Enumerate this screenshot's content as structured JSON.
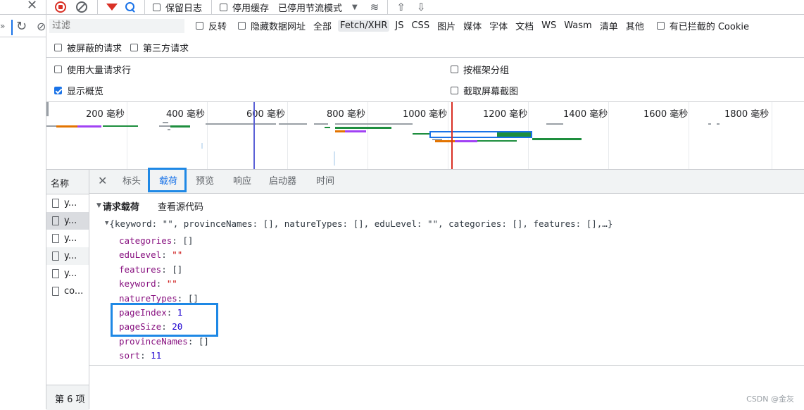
{
  "toolbar": {
    "preserve_log": "保留日志",
    "disable_cache": "停用缓存",
    "throttle": "已停用节流模式"
  },
  "filter_bar": {
    "placeholder": "过滤",
    "invert": "反转",
    "hide_data_urls": "隐藏数据网址",
    "types": [
      "全部",
      "Fetch/XHR",
      "JS",
      "CSS",
      "图片",
      "媒体",
      "字体",
      "文档",
      "WS",
      "Wasm",
      "清单",
      "其他"
    ],
    "active_type": "Fetch/XHR",
    "blocked_cookies": "有已拦截的 Cookie",
    "blocked_requests": "被屏蔽的请求",
    "third_party": "第三方请求"
  },
  "settings": {
    "big_rows": "使用大量请求行",
    "group_by_frame": "按框架分组",
    "show_overview": "显示概览",
    "capture_screenshots": "截取屏幕截图"
  },
  "overview": {
    "ticks": [
      "200 毫秒",
      "400 毫秒",
      "600 毫秒",
      "800 毫秒",
      "1000 毫秒",
      "1200 毫秒",
      "1400 毫秒",
      "1600 毫秒",
      "1800 毫秒"
    ]
  },
  "request_list": {
    "header": "名称",
    "items": [
      "y...",
      "y...",
      "y...",
      "y...",
      "y...",
      "co..."
    ],
    "footer": "第 6 项"
  },
  "details": {
    "tabs": [
      "标头",
      "载荷",
      "预览",
      "响应",
      "启动器",
      "时间"
    ],
    "active_tab": "载荷",
    "section_title": "请求载荷",
    "view_source": "查看源代码",
    "summary": "{keyword: \"\", provinceNames: [], natureTypes: [], eduLevel: \"\", categories: [], features: [],…}",
    "fields": [
      {
        "key": "categories",
        "value": "[]",
        "kind": "plain"
      },
      {
        "key": "eduLevel",
        "value": "\"\"",
        "kind": "str"
      },
      {
        "key": "features",
        "value": "[]",
        "kind": "plain"
      },
      {
        "key": "keyword",
        "value": "\"\"",
        "kind": "str"
      },
      {
        "key": "natureTypes",
        "value": "[]",
        "kind": "plain"
      },
      {
        "key": "pageIndex",
        "value": "1",
        "kind": "num"
      },
      {
        "key": "pageSize",
        "value": "20",
        "kind": "num"
      },
      {
        "key": "provinceNames",
        "value": "[]",
        "kind": "plain"
      },
      {
        "key": "sort",
        "value": "11",
        "kind": "num"
      }
    ]
  },
  "watermark": "CSDN @金灰",
  "colors": {
    "highlight_box": "#1e88e5",
    "active_tab_text": "#1a73e8",
    "record_stop": "#d93025",
    "filter_icon": "#d93025"
  }
}
